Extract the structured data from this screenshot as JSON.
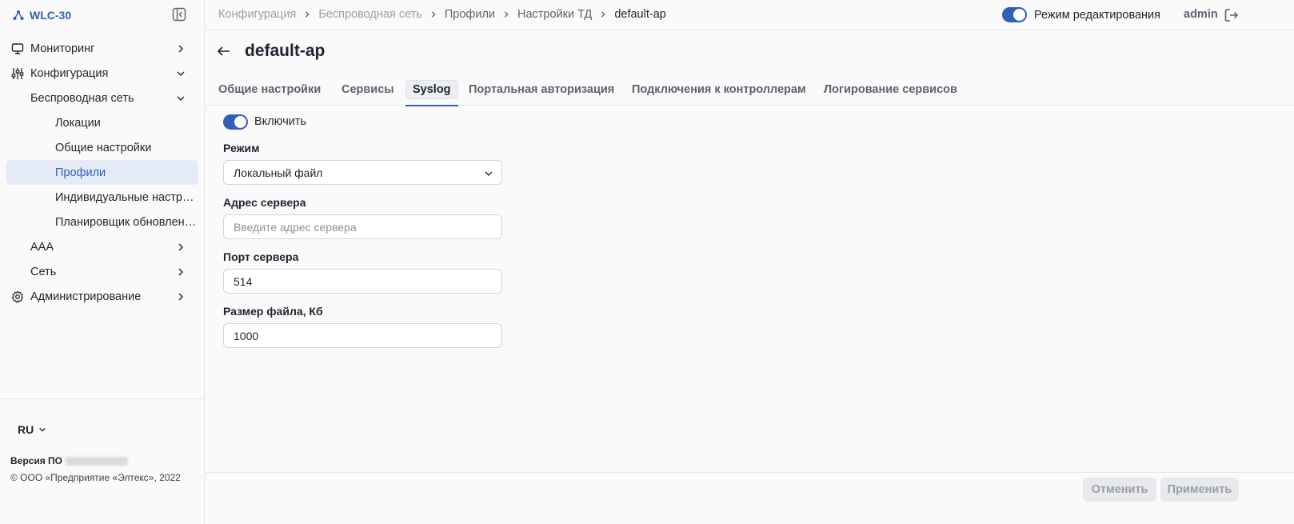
{
  "app": {
    "name": "WLC-30"
  },
  "sidebar": {
    "items": [
      {
        "label": "Мониторинг",
        "icon": "monitor-icon"
      },
      {
        "label": "Конфигурация",
        "icon": "sliders-icon"
      },
      {
        "label": "Беспроводная сеть"
      },
      {
        "label": "Локации"
      },
      {
        "label": "Общие настройки"
      },
      {
        "label": "Профили"
      },
      {
        "label": "Индивидуальные настройки"
      },
      {
        "label": "Планировщик обновлений"
      },
      {
        "label": "AAA"
      },
      {
        "label": "Сеть"
      },
      {
        "label": "Администрирование",
        "icon": "gear-icon"
      }
    ],
    "language": "RU",
    "version_label": "Версия ПО",
    "copyright": "© ООО «Предприятие «Элтекс», 2022"
  },
  "topbar": {
    "breadcrumb": [
      "Конфигурация",
      "Беспроводная сеть",
      "Профили",
      "Настройки ТД",
      "default-ap"
    ],
    "edit_mode_label": "Режим редактирования",
    "edit_mode_on": true,
    "user": "admin"
  },
  "page": {
    "title": "default-ap",
    "tabs": [
      "Общие настройки",
      "Сервисы",
      "Syslog",
      "Портальная авторизация",
      "Подключения к контроллерам",
      "Логирование сервисов"
    ],
    "active_tab": "Syslog"
  },
  "form": {
    "enable_label": "Включить",
    "enabled": true,
    "mode_label": "Режим",
    "mode_value": "Локальный файл",
    "server_address_label": "Адрес сервера",
    "server_address_placeholder": "Введите адрес сервера",
    "server_port_label": "Порт сервера",
    "server_port_value": "514",
    "file_size_label": "Размер файла, Кб",
    "file_size_value": "1000"
  },
  "footer": {
    "cancel_label": "Отменить",
    "apply_label": "Применить"
  },
  "colors": {
    "accent": "#2f5fb8",
    "active_bg": "#e4ebf6",
    "disabled_btn": "#e8e9ec"
  }
}
